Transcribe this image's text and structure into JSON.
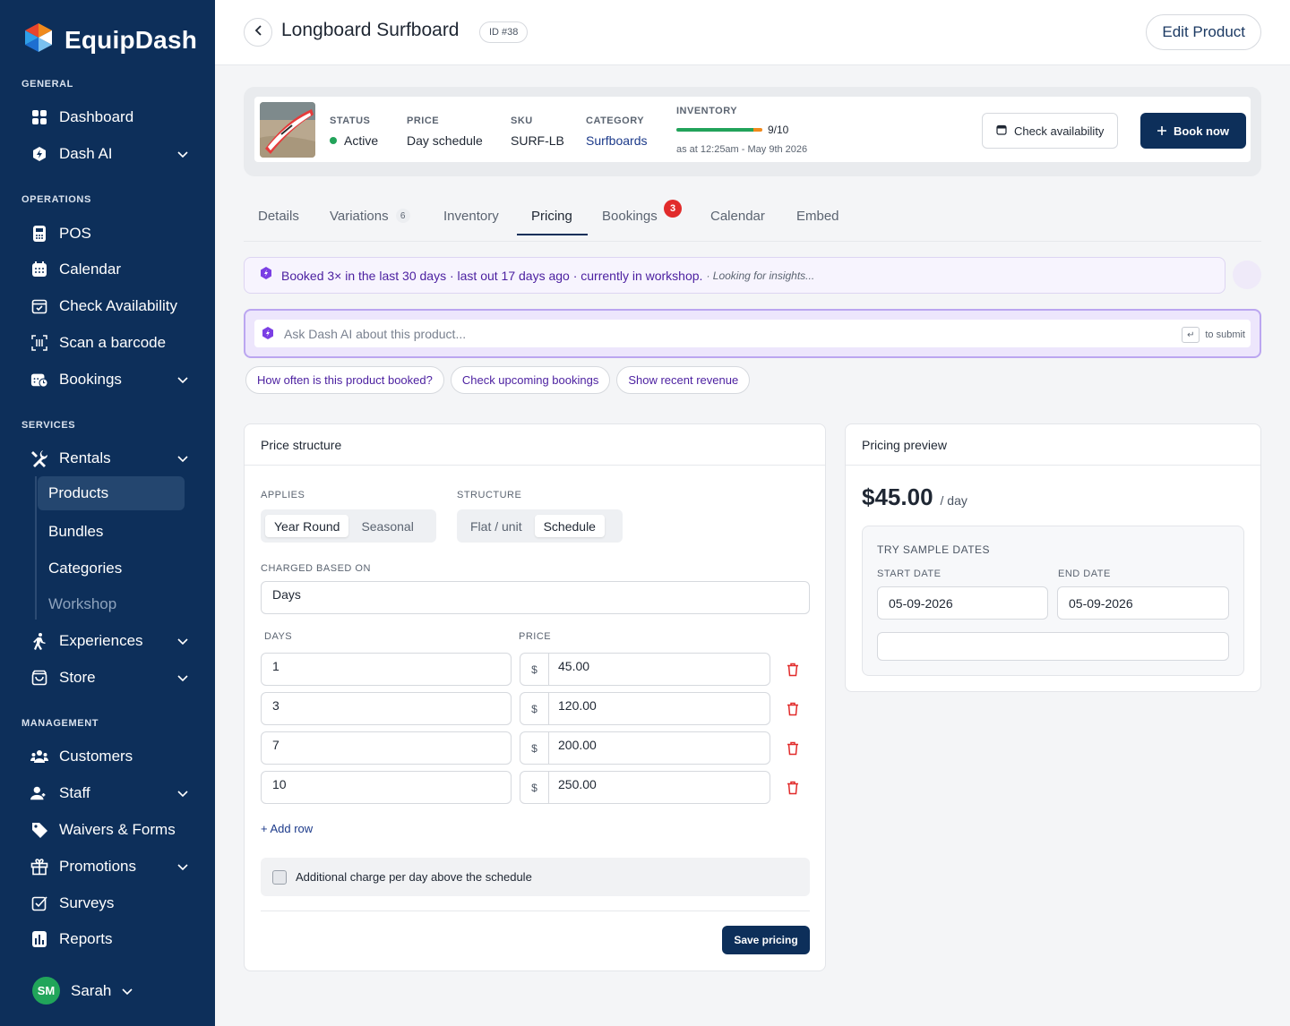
{
  "brand": {
    "name": "EquipDash"
  },
  "sidebar": {
    "sections": {
      "general": "GENERAL",
      "operations": "OPERATIONS",
      "services": "SERVICES",
      "management": "MANAGEMENT"
    },
    "items": {
      "dashboard": "Dashboard",
      "dash_ai": "Dash AI",
      "pos": "POS",
      "calendar": "Calendar",
      "check_availability": "Check Availability",
      "scan": "Scan a barcode",
      "bookings": "Bookings",
      "rentals": "Rentals",
      "products": "Products",
      "bundles": "Bundles",
      "categories": "Categories",
      "workshop": "Workshop",
      "experiences": "Experiences",
      "store": "Store",
      "customers": "Customers",
      "staff": "Staff",
      "waivers": "Waivers & Forms",
      "promotions": "Promotions",
      "surveys": "Surveys",
      "reports": "Reports"
    },
    "user": {
      "initials": "SM",
      "name": "Sarah"
    }
  },
  "header": {
    "title": "Longboard Surfboard",
    "id_chip": "ID #38",
    "edit_label": "Edit Product"
  },
  "summary": {
    "status_label": "STATUS",
    "status_value": "Active",
    "price_label": "PRICE",
    "price_value": "Day schedule",
    "sku_label": "SKU",
    "sku_value": "SURF-LB",
    "category_label": "CATEGORY",
    "category_value": "Surfboards",
    "inventory_label": "INVENTORY",
    "inventory_value": "9/10",
    "inventory_fraction": 0.9,
    "inventory_asat": "as at 12:25am - May 9th 2026",
    "check_label": "Check availability",
    "book_label": "Book now"
  },
  "tabs": {
    "details": "Details",
    "variations": "Variations",
    "variations_count": "6",
    "inventory": "Inventory",
    "pricing": "Pricing",
    "bookings": "Bookings",
    "bookings_badge": "3",
    "calendar": "Calendar",
    "embed": "Embed"
  },
  "insight": {
    "text": "Booked 3× in the last 30 days · last out 17 days ago · currently in workshop.",
    "sub": "· Looking for insights..."
  },
  "ask": {
    "placeholder": "Ask Dash AI about this product...",
    "hint": "to submit",
    "kbd": "↵"
  },
  "chips": {
    "c1": "How often is this product booked?",
    "c2": "Check upcoming bookings",
    "c3": "Show recent revenue"
  },
  "price_structure": {
    "title": "Price structure",
    "applies_label": "APPLIES",
    "applies_options": [
      "Year Round",
      "Seasonal"
    ],
    "structure_label": "STRUCTURE",
    "structure_options": [
      "Flat / unit",
      "Schedule"
    ],
    "charged_label": "CHARGED BASED ON",
    "charged_value": "Days",
    "days_header": "DAYS",
    "price_header": "PRICE",
    "currency": "$",
    "rows": [
      {
        "days": "1",
        "price": "45.00"
      },
      {
        "days": "3",
        "price": "120.00"
      },
      {
        "days": "7",
        "price": "200.00"
      },
      {
        "days": "10",
        "price": "250.00"
      }
    ],
    "add_row": "+ Add row",
    "extra_label": "Additional charge per day above the schedule",
    "save_label": "Save pricing"
  },
  "preview": {
    "title": "Pricing preview",
    "price": "$45.00",
    "per": "/ day",
    "sample_title": "TRY SAMPLE DATES",
    "start_label": "START DATE",
    "start_value": "05-09-2026",
    "end_label": "END DATE",
    "end_value": "05-09-2026",
    "result": ""
  },
  "colors": {
    "sidebar_bg": "#0d2f5a",
    "accent_purple": "#4b1fa0",
    "status_green": "#22a35a",
    "danger_red": "#e12b2b"
  }
}
